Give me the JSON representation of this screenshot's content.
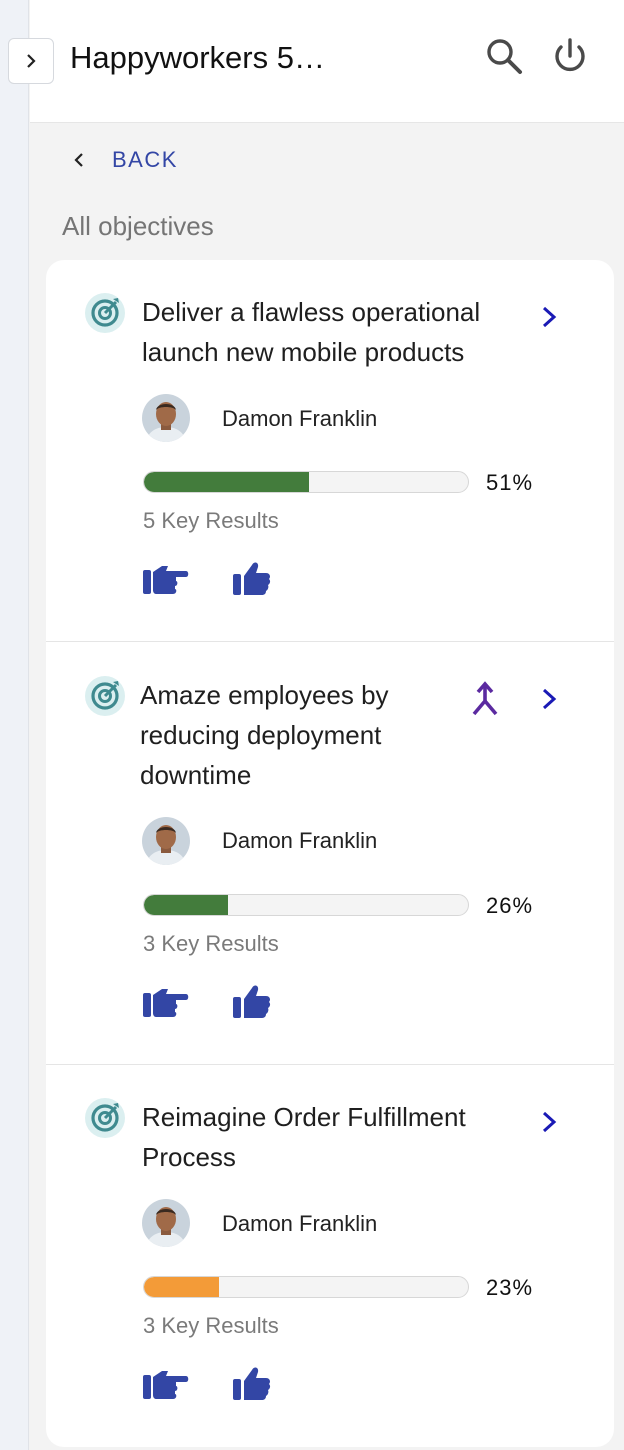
{
  "header": {
    "title": "Happyworkers 5…"
  },
  "nav": {
    "back_label": "BACK"
  },
  "section": {
    "title": "All objectives"
  },
  "colors": {
    "accent": "#3346a5",
    "progress_green": "#437c3c",
    "progress_orange": "#f39b38",
    "icon_teal": "#3f8a8f"
  },
  "objectives": [
    {
      "title_lines": [
        "Deliver a flawless operational",
        "launch new mobile products"
      ],
      "owner": "Damon Franklin",
      "progress": 51,
      "progress_label": "51%",
      "key_results": "5 Key Results",
      "progress_color": "#437c3c",
      "aligned": false
    },
    {
      "title_lines": [
        "Amaze employees by",
        "reducing deployment",
        "downtime"
      ],
      "owner": "Damon Franklin",
      "progress": 26,
      "progress_label": "26%",
      "key_results": "3 Key Results",
      "progress_color": "#437c3c",
      "aligned": true
    },
    {
      "title_lines": [
        "Reimagine Order Fulfillment",
        "Process"
      ],
      "owner": "Damon Franklin",
      "progress": 23,
      "progress_label": "23%",
      "key_results": "3 Key Results",
      "progress_color": "#f39b38",
      "aligned": false
    }
  ]
}
